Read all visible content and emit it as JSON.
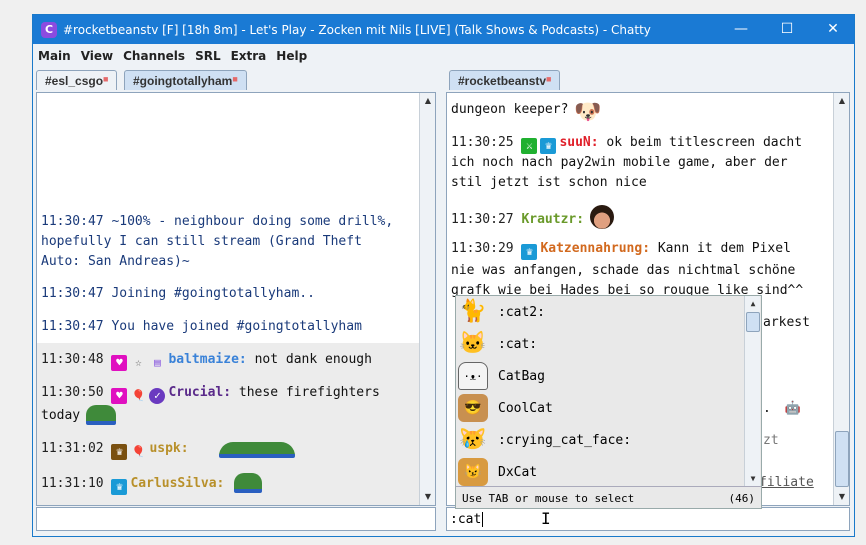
{
  "window": {
    "title": "#rocketbeanstv [F] [18h 8m] - Let's Play - Zocken mit Nils  [LIVE] (Talk Shows & Podcasts) - Chatty",
    "app_icon": "C",
    "minimize": "—",
    "maximize": "☐",
    "close": "✕"
  },
  "menu": [
    "Main",
    "View",
    "Channels",
    "SRL",
    "Extra",
    "Help"
  ],
  "left": {
    "tabs": [
      "#esl_csgo",
      "#goingtotallyham"
    ],
    "messages": [
      {
        "text": "11:30:47 ~100% - neighbour doing some drill%,"
      },
      {
        "text": "hopefully I can still stream (Grand Theft"
      },
      {
        "text": "Auto: San Andreas)~"
      },
      {
        "text": "11:30:47 Joining #goingtotallyham.."
      },
      {
        "text": "11:30:47 You have joined #goingtotallyham"
      },
      {
        "ts": "11:30:48",
        "user": "baltmaize:",
        "msg": "not dank enough",
        "color": "#3a82d8"
      },
      {
        "ts": "11:30:50",
        "user": "Crucial:",
        "msg": "these firefighters",
        "color": "#5a2a8a"
      },
      {
        "text": "today"
      },
      {
        "ts": "11:31:02",
        "user": "uspk:",
        "msg": "",
        "color": "#b8902a"
      },
      {
        "ts": "11:31:10",
        "user": "CarlusSilva:",
        "msg": "",
        "color": "#b8902a"
      }
    ],
    "input": ""
  },
  "right": {
    "tab": "#rocketbeanstv",
    "messages": [
      {
        "text": "dungeon keeper?"
      },
      {
        "ts": "11:30:25",
        "user": "suuN:",
        "msg": "ok beim titlescreen dacht",
        "color": "#e0202a"
      },
      {
        "text": "ich noch nach pay2win mobile game, aber der"
      },
      {
        "text": "stil jetzt ist schon nice"
      },
      {
        "ts": "11:30:27",
        "user": "Krautzr:",
        "msg": "",
        "color": "#6a9a2a"
      },
      {
        "ts": "11:30:29",
        "user": "Katzennahrung:",
        "msg": "Kann it dem Pixel",
        "color": "#d2691e"
      },
      {
        "text": "nie was anfangen, schade das nichtmal schöne"
      },
      {
        "text": "grafk wie bei Hades bei so rougue like sind^^"
      }
    ],
    "hidden_fragments": [
      "arkest",
      ".",
      "zt",
      "filiate"
    ],
    "input": ":cat"
  },
  "autocomplete": {
    "items": [
      ":cat2:",
      ":cat:",
      "CatBag",
      "CoolCat",
      ":crying_cat_face:",
      "DxCat"
    ],
    "hint": "Use TAB or mouse to select",
    "count": "(46)"
  }
}
